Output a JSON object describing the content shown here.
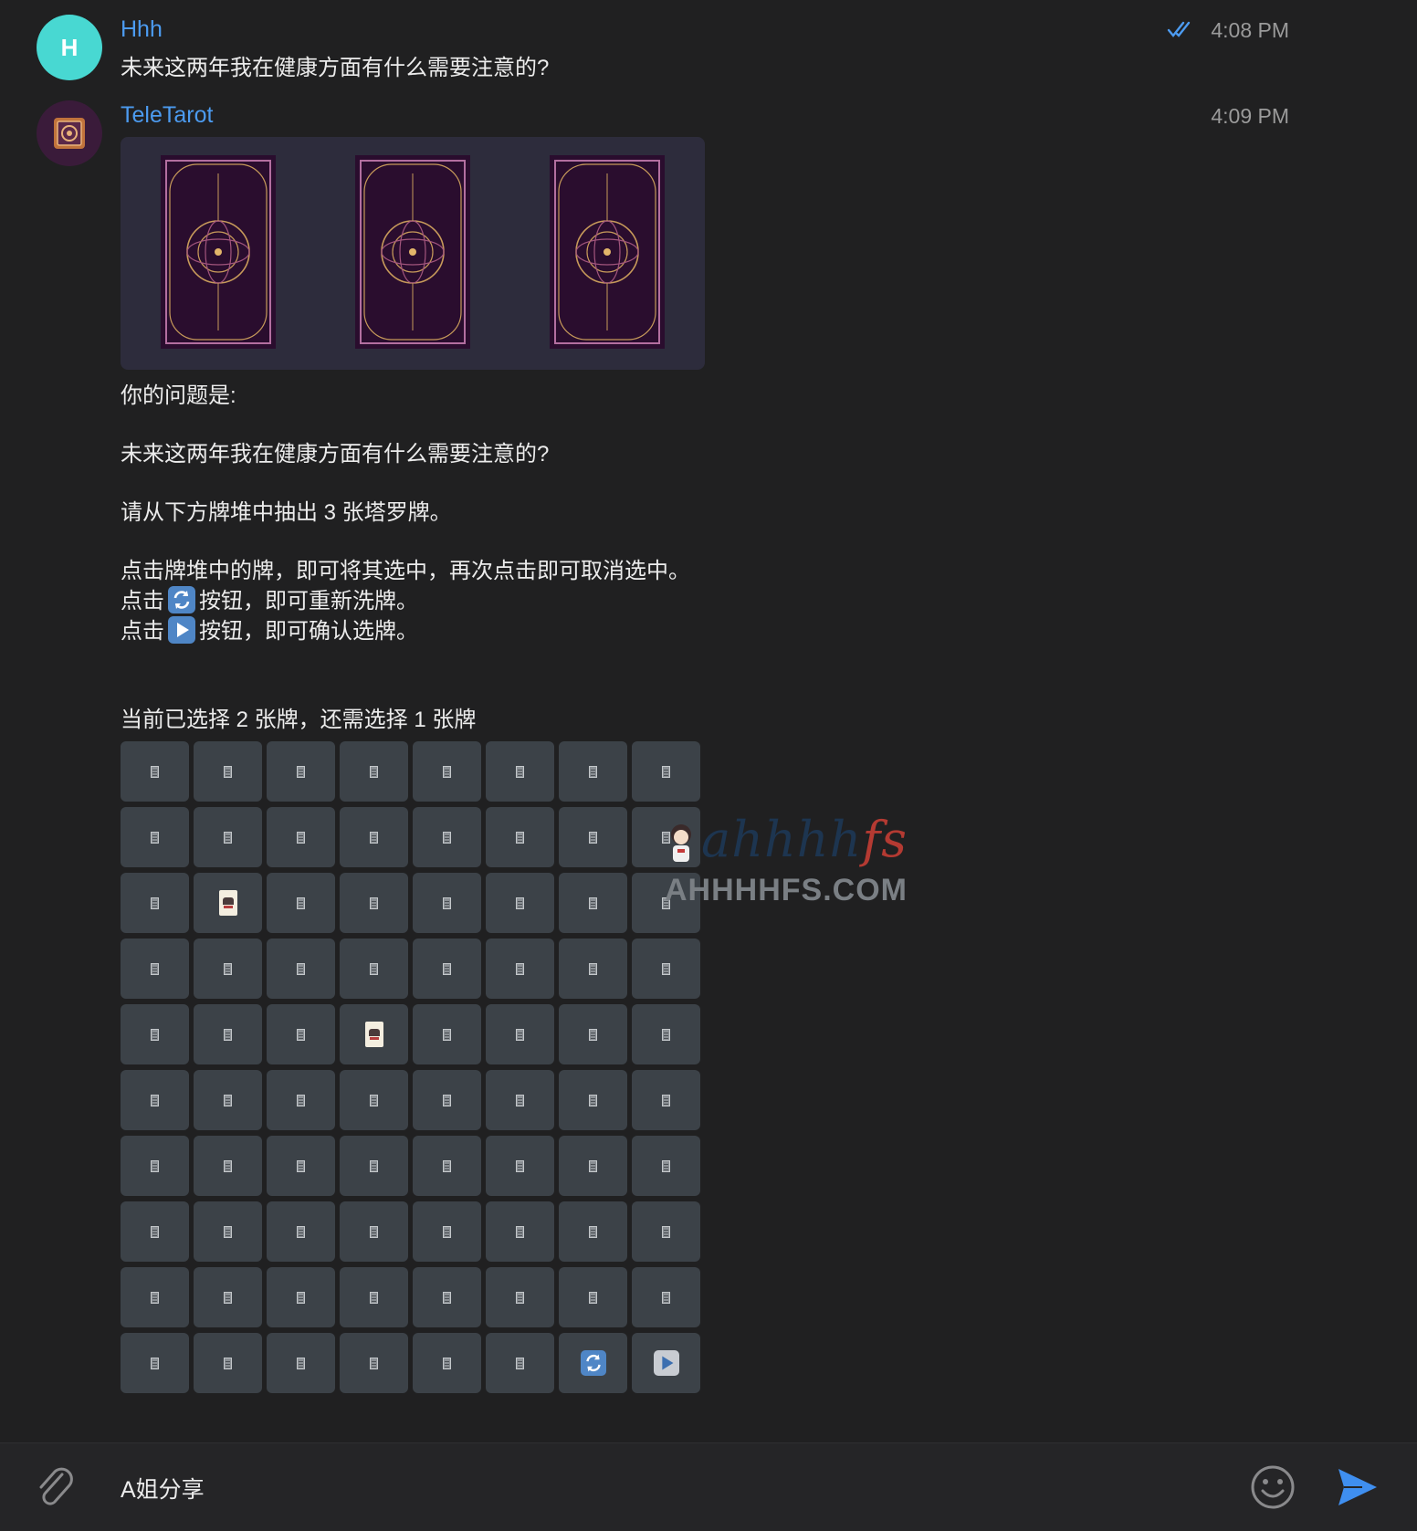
{
  "user_message": {
    "avatar_initial": "H",
    "sender": "Hhh",
    "text": "未来这两年我在健康方面有什么需要注意的?",
    "time": "4:08 PM",
    "read_status_icon": "double-check-icon"
  },
  "bot_message": {
    "sender": "TeleTarot",
    "time": "4:09 PM",
    "cards_shown": 3,
    "lines": [
      "你的问题是:",
      "",
      "未来这两年我在健康方面有什么需要注意的?",
      "",
      "请从下方牌堆中抽出 3 张塔罗牌。",
      "",
      "点击牌堆中的牌，即可将其选中，再次点击即可取消选中。"
    ],
    "instruction_shuffle": {
      "prefix": "点击",
      "suffix": "按钮，即可重新洗牌。",
      "icon": "shuffle-icon"
    },
    "instruction_confirm": {
      "prefix": "点击",
      "suffix": "按钮，即可确认选牌。",
      "icon": "play-icon"
    },
    "status": "当前已选择 2 张牌，还需选择 1 张牌"
  },
  "keyboard": {
    "columns": 8,
    "rows": 10,
    "card_button_icon": "card-back-icon",
    "selected_icon": "selected-card-icon",
    "selected_cells": [
      17,
      35
    ],
    "shuffle_button_icon": "shuffle-icon",
    "confirm_button_icon": "play-icon"
  },
  "watermark": {
    "script_text": "ahhhhfs",
    "domain_text": "AHHHHFS.COM"
  },
  "composer": {
    "value": "A姐分享",
    "attach_icon": "paperclip-icon",
    "emoji_icon": "emoji-icon",
    "send_icon": "send-icon"
  },
  "colors": {
    "background": "#202021",
    "accent": "#4c9bf0",
    "key_bg": "#3c4248",
    "user_avatar": "#48d8d2"
  }
}
